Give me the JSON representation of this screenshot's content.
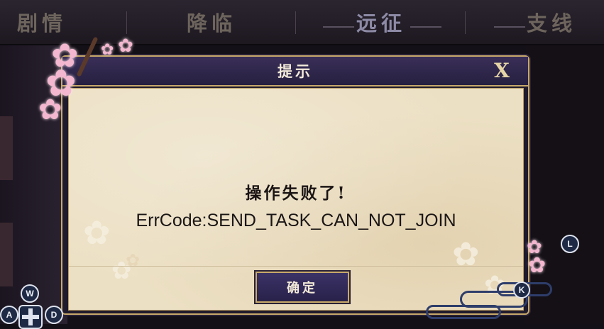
{
  "tabs": [
    {
      "label": "剧情",
      "active": false
    },
    {
      "label": "降临",
      "active": false
    },
    {
      "label": "远征",
      "active": true
    },
    {
      "label": "支线",
      "active": false
    }
  ],
  "dialog": {
    "title": "提示",
    "close_label": "X",
    "message": "操作失败了!",
    "error_code": "ErrCode:SEND_TASK_CAN_NOT_JOIN",
    "confirm_label": "确定"
  },
  "key_hints": {
    "l": "L",
    "k": "K",
    "w": "W",
    "a": "A",
    "d": "D"
  },
  "colors": {
    "frame_gold": "#c8a96a",
    "header_purple": "#2e2650",
    "parchment": "#ece0c4"
  }
}
